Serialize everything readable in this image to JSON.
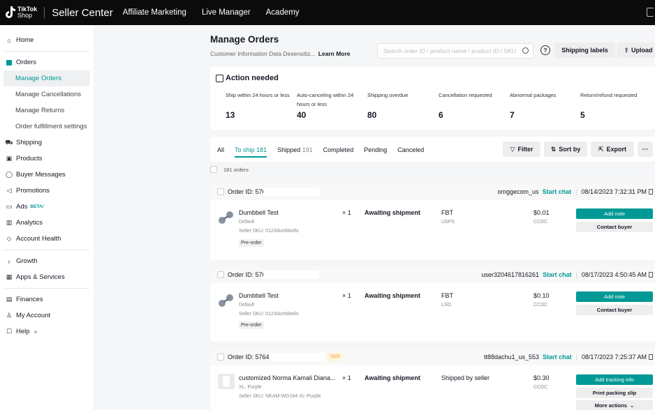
{
  "topbar": {
    "logo_line1": "TikTok",
    "logo_line2": "Shop",
    "title": "Seller Center",
    "nav": [
      "Affiliate Marketing",
      "Live Manager",
      "Academy"
    ]
  },
  "sidebar": {
    "home": "Home",
    "orders": "Orders",
    "orders_sub": [
      "Manage Orders",
      "Manage Cancellations",
      "Manage Returns",
      "Order fulfillment settings"
    ],
    "shipping": "Shipping",
    "products": "Products",
    "buyer_messages": "Buyer Messages",
    "promotions": "Promotions",
    "ads": "Ads",
    "ads_badge": "BETA!",
    "analytics": "Analytics",
    "account_health": "Account Health",
    "growth": "Growth",
    "apps_services": "Apps & Services",
    "finances": "Finances",
    "my_account": "My Account",
    "help": "Help"
  },
  "header": {
    "title": "Manage Orders",
    "subtitle": "Customer Information Data Desensitiz...",
    "learn_more": "Learn More",
    "search_placeholder": "Search order ID / product name / product ID / SKU",
    "help_glyph": "?",
    "shipping_labels": "Shipping labels",
    "upload": "Upload"
  },
  "action_needed": {
    "title": "Action needed",
    "metrics": [
      {
        "label": "Ship within 24 hours or less",
        "value": "13"
      },
      {
        "label": "Auto-canceling within 24 hours or less",
        "value": "40"
      },
      {
        "label": "Shipping overdue",
        "value": "80"
      },
      {
        "label": "Cancellation requested",
        "value": "6"
      },
      {
        "label": "Abnormal packages",
        "value": "7"
      },
      {
        "label": "Return/refund requested",
        "value": "5"
      }
    ]
  },
  "tabs": {
    "all": "All",
    "to_ship": "To ship",
    "to_ship_count": "181",
    "shipped": "Shipped",
    "shipped_count": "191",
    "completed": "Completed",
    "pending": "Pending",
    "canceled": "Canceled",
    "filter": "Filter",
    "sort_by": "Sort by",
    "export": "Export",
    "more": "···"
  },
  "orders_count": "181 orders",
  "orders": [
    {
      "id_prefix": "Order ID: 5764",
      "buyer": "omggecom_us",
      "chat": "Start chat",
      "date": "08/14/2023 7:32:31 PM",
      "product": "Dumbbell Test",
      "variant": "Default",
      "sku": "Seller SKU: 0123dumbbells",
      "tag": "Pre-order",
      "qty": "× 1",
      "status": "Awaiting shipment",
      "shipping": "FBT",
      "carrier": "USPS",
      "price": "$0.01",
      "currency": "CCDC",
      "actions": [
        "Add note",
        "Contact buyer"
      ]
    },
    {
      "id_prefix": "Order ID: 57647",
      "buyer": "user3204617816261",
      "chat": "Start chat",
      "date": "08/17/2023 4:50:45 AM",
      "product": "Dumbbell Test",
      "variant": "Default",
      "sku": "Seller SKU: 0123dumbbells",
      "tag": "Pre-order",
      "qty": "× 1",
      "status": "Awaiting shipment",
      "shipping": "FBT",
      "carrier": "LSO",
      "price": "$0.10",
      "currency": "CCDC",
      "actions": [
        "Add note",
        "Contact buyer"
      ]
    },
    {
      "id_prefix": "Order ID: 57647",
      "split": "Split",
      "buyer": "tt88dachu1_us_553",
      "chat": "Start chat",
      "date": "08/17/2023 7:25:37 AM",
      "product": "customized Norma Kamali Diana...",
      "variant": "XL, Purple",
      "sku": "Seller SKU: NKAM-WD184-XL-Purple",
      "qty": "× 1",
      "status": "Awaiting shipment",
      "shipping": "Shipped by seller",
      "price": "$0.30",
      "currency": "CCDC",
      "actions": [
        "Add tracking info",
        "Print packing slip",
        "More actions"
      ]
    }
  ],
  "colors": {
    "accent": "#009995",
    "topbar": "#0b0b0b"
  }
}
